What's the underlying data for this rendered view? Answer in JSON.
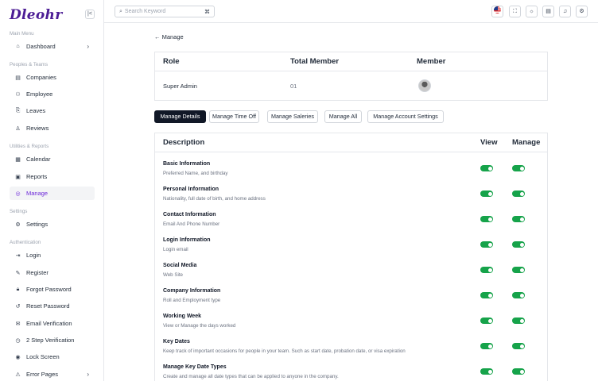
{
  "app": {
    "logo": "Dleohr",
    "collapse_icon": "|<"
  },
  "sidebar": {
    "sections": [
      {
        "label": "Main Menu"
      },
      {
        "label": "Peoples & Teams"
      },
      {
        "label": "Utilities & Reports"
      },
      {
        "label": "Settings"
      },
      {
        "label": "Authentication"
      }
    ],
    "items": [
      {
        "label": "Dashboard",
        "icon": "⌂",
        "chevron": "›"
      },
      {
        "label": "Companies",
        "icon": "▤"
      },
      {
        "label": "Employee",
        "icon": "⚇"
      },
      {
        "label": "Leaves",
        "icon": "⎘"
      },
      {
        "label": "Reviews",
        "icon": "♙"
      },
      {
        "label": "Calendar",
        "icon": "▦"
      },
      {
        "label": "Reports",
        "icon": "▣"
      },
      {
        "label": "Manage",
        "icon": "◎",
        "active": true
      },
      {
        "label": "Settings",
        "icon": "⚙"
      },
      {
        "label": "Login",
        "icon": "⇥"
      },
      {
        "label": "Register",
        "icon": "✎"
      },
      {
        "label": "Forgot Password",
        "icon": "🔒︎"
      },
      {
        "label": "Reset Password",
        "icon": "↺"
      },
      {
        "label": "Email Verification",
        "icon": "✉"
      },
      {
        "label": "2 Step Verification",
        "icon": "◷"
      },
      {
        "label": "Lock Screen",
        "icon": "◉"
      },
      {
        "label": "Error Pages",
        "icon": "⚠",
        "chevron": "›"
      }
    ]
  },
  "header": {
    "search": {
      "placeholder": "Search Keyword",
      "shortcut": "⌘"
    },
    "buttons": [
      {
        "name": "language-flag-icon"
      },
      {
        "name": "fullscreen-icon",
        "glyph": "⛶"
      },
      {
        "name": "theme-toggle-icon",
        "glyph": "☼"
      },
      {
        "name": "calendar-check-icon",
        "glyph": "▤"
      },
      {
        "name": "notification-bell-icon",
        "glyph": "♫"
      },
      {
        "name": "settings-gear-icon",
        "glyph": "⚙"
      }
    ]
  },
  "main": {
    "back_label": "← Manage",
    "role_table": {
      "headers": {
        "role": "Role",
        "total": "Total Member",
        "member": "Member"
      },
      "row": {
        "role": "Super Admin",
        "total": "01"
      }
    },
    "tabs": [
      {
        "label": "Manage Details",
        "active": true
      },
      {
        "label": "Manage Time Off"
      },
      {
        "label": "Manage Saleries"
      },
      {
        "label": "Manage All"
      },
      {
        "label": "Manage Account Settings"
      }
    ],
    "permissions": {
      "headers": {
        "description": "Description",
        "view": "View",
        "manage": "Manage"
      },
      "rows": [
        {
          "title": "Basic Information",
          "desc": "Preferred Name, and birthday",
          "view": true,
          "manage": true
        },
        {
          "title": "Personal Information",
          "desc": "Nationality, full date of birth, and home address",
          "view": true,
          "manage": true
        },
        {
          "title": "Contact Information",
          "desc": "Email And Phone Number",
          "view": true,
          "manage": true
        },
        {
          "title": "Login Information",
          "desc": "Login email",
          "view": true,
          "manage": true
        },
        {
          "title": "Social Media",
          "desc": "Web Site",
          "view": true,
          "manage": true
        },
        {
          "title": "Company Information",
          "desc": "Roll and Employment type",
          "view": true,
          "manage": true
        },
        {
          "title": "Working Week",
          "desc": "View or Manage the days worked",
          "view": true,
          "manage": true
        },
        {
          "title": "Key Dates",
          "desc": "Keep track of important occasions for people in your team. Such as start date, probation date, or visa expiration",
          "view": true,
          "manage": true
        },
        {
          "title": "Manage Key Date Types",
          "desc": "Create and manage all date types that can be applied to anyone in the company.",
          "view": true,
          "manage": true
        }
      ]
    }
  }
}
